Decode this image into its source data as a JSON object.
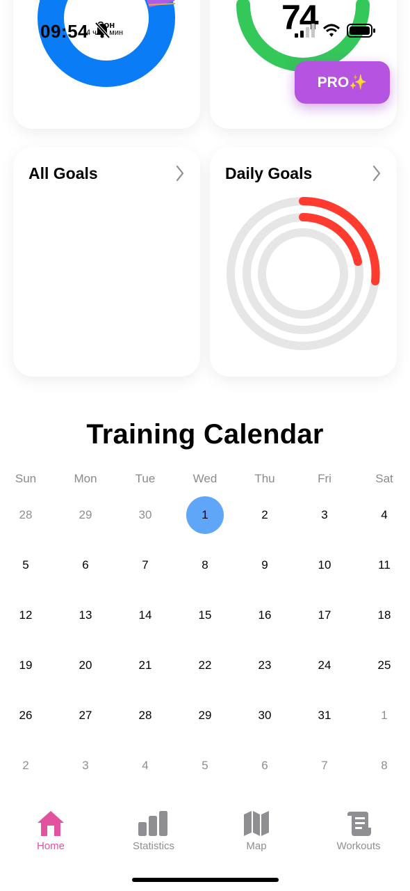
{
  "status": {
    "time": "09:54",
    "note_title": "Сон",
    "note_sub": "4 ч 23 мин",
    "score": "74"
  },
  "pro_button": {
    "label": "PRO✨"
  },
  "cards": {
    "all_goals": {
      "title": "All Goals"
    },
    "daily_goals": {
      "title": "Daily Goals",
      "rings_progress": [
        0.26,
        0.23,
        0.0
      ]
    }
  },
  "calendar": {
    "title": "Training Calendar",
    "weekdays": [
      "Sun",
      "Mon",
      "Tue",
      "Wed",
      "Thu",
      "Fri",
      "Sat"
    ],
    "weeks": [
      [
        {
          "d": "28",
          "other": true
        },
        {
          "d": "29",
          "other": true
        },
        {
          "d": "30",
          "other": true
        },
        {
          "d": "1",
          "selected": true
        },
        {
          "d": "2"
        },
        {
          "d": "3"
        },
        {
          "d": "4"
        }
      ],
      [
        {
          "d": "5"
        },
        {
          "d": "6"
        },
        {
          "d": "7"
        },
        {
          "d": "8"
        },
        {
          "d": "9"
        },
        {
          "d": "10"
        },
        {
          "d": "11"
        }
      ],
      [
        {
          "d": "12"
        },
        {
          "d": "13"
        },
        {
          "d": "14"
        },
        {
          "d": "15"
        },
        {
          "d": "16"
        },
        {
          "d": "17"
        },
        {
          "d": "18"
        }
      ],
      [
        {
          "d": "19"
        },
        {
          "d": "20"
        },
        {
          "d": "21"
        },
        {
          "d": "22"
        },
        {
          "d": "23"
        },
        {
          "d": "24"
        },
        {
          "d": "25"
        }
      ],
      [
        {
          "d": "26"
        },
        {
          "d": "27"
        },
        {
          "d": "28"
        },
        {
          "d": "29"
        },
        {
          "d": "30"
        },
        {
          "d": "31"
        },
        {
          "d": "1",
          "other": true
        }
      ],
      [
        {
          "d": "2",
          "other": true
        },
        {
          "d": "3",
          "other": true
        },
        {
          "d": "4",
          "other": true
        },
        {
          "d": "5",
          "other": true
        },
        {
          "d": "6",
          "other": true
        },
        {
          "d": "7",
          "other": true
        },
        {
          "d": "8",
          "other": true
        }
      ]
    ]
  },
  "tabbar": {
    "items": [
      {
        "label": "Home",
        "icon": "home-icon",
        "active": true
      },
      {
        "label": "Statistics",
        "icon": "bar-chart-icon"
      },
      {
        "label": "Map",
        "icon": "map-icon"
      },
      {
        "label": "Workouts",
        "icon": "scroll-icon"
      }
    ]
  },
  "colors": {
    "accent_pink": "#e2529f",
    "pro_purple": "#b454e0",
    "selected_day": "#5fa6f8",
    "goal_ring_red": "#ff3b30",
    "ring_track": "#e6e6e6",
    "donut_blue": "#0a7cf5",
    "donut_red": "#ff2d55",
    "donut_purple": "#b05ce6",
    "ring_green": "#34c759"
  }
}
